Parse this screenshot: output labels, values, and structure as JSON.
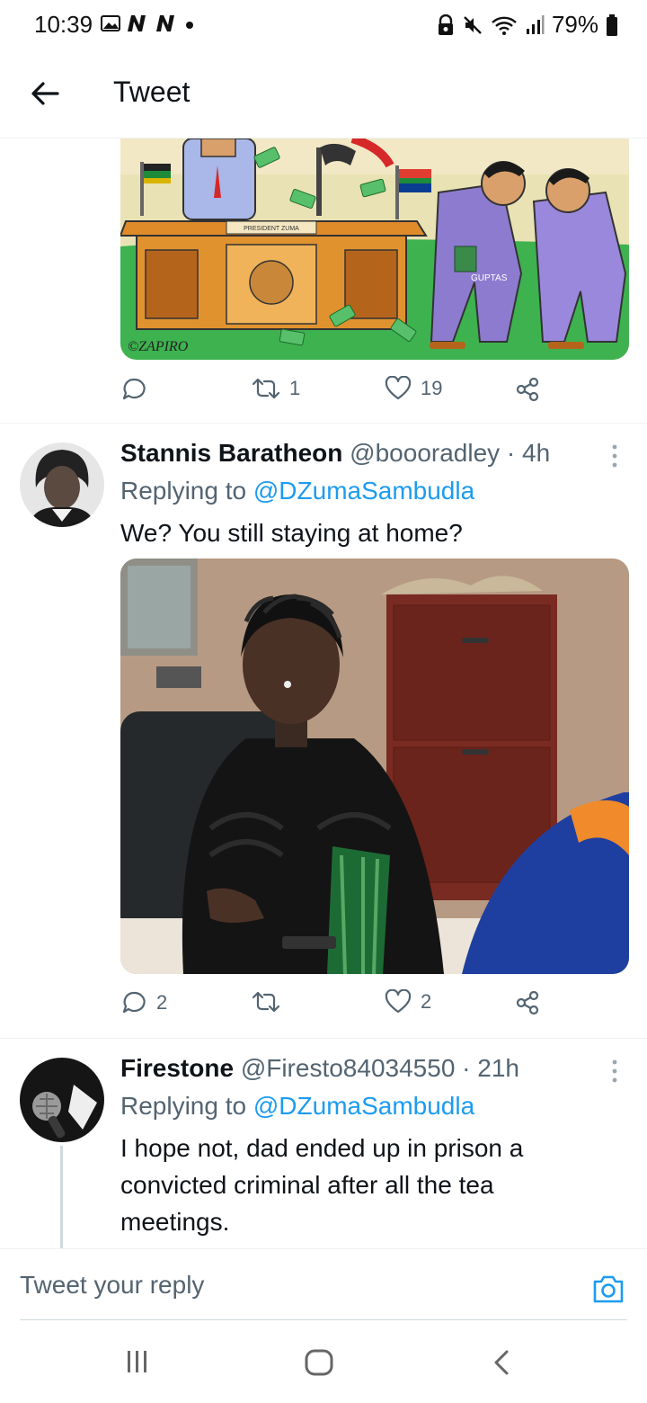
{
  "status_bar": {
    "time": "10:39",
    "battery": "79%",
    "icons": [
      "gallery-icon",
      "n-app-icon",
      "n-app-icon",
      "dot-icon",
      "sync-lock-icon",
      "mute-icon",
      "wifi-icon",
      "signal-icon",
      "battery-icon"
    ]
  },
  "header": {
    "title": "Tweet",
    "back_icon": "arrow-left-icon"
  },
  "cartoon_image": {
    "desk_plate": "PRESIDENT ZUMA",
    "bag_label": "GUPTAS",
    "signature": "©ZAPIRO"
  },
  "tweet0_actions": {
    "reply_count": "",
    "retweet_count": "1",
    "like_count": "19"
  },
  "tweet1": {
    "name": "Stannis Baratheon",
    "meta": "@boooradley · 4h",
    "replying_prefix": "Replying to ",
    "replying_to": "@DZumaSambudla",
    "text": "We? You still staying at home?",
    "actions": {
      "reply_count": "2",
      "retweet_count": "",
      "like_count": "2"
    }
  },
  "tweet2": {
    "name": "Firestone",
    "meta": "@Firesto84034550 · 21h",
    "replying_prefix": "Replying to ",
    "replying_to": "@DZumaSambudla",
    "text": "I hope not, dad ended up in prison a convicted criminal after all the tea meetings."
  },
  "reply_bar": {
    "placeholder": "Tweet your reply"
  },
  "colors": {
    "accent": "#1d9bf0",
    "text": "#0f1419",
    "muted": "#536471",
    "divider": "#eff3f4"
  }
}
